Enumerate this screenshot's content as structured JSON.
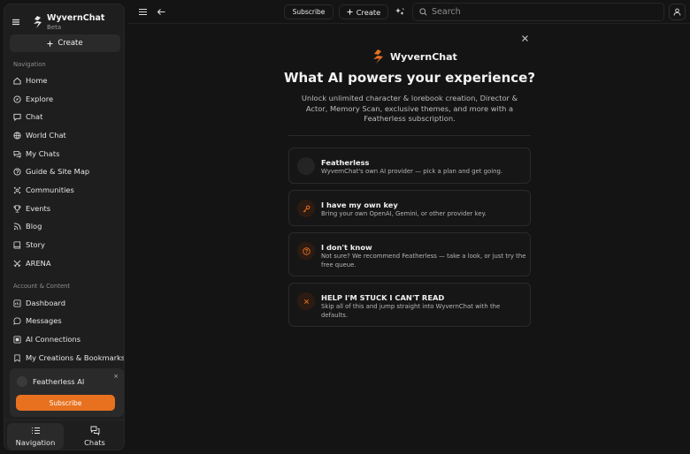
{
  "app": {
    "name": "WyvernChat",
    "tag": "Beta",
    "accent": "#e8711f"
  },
  "sidebar": {
    "create_label": "Create",
    "navigation_label": "Navigation",
    "nav_items": [
      {
        "label": "Home",
        "icon": "home-icon"
      },
      {
        "label": "Explore",
        "icon": "compass-icon"
      },
      {
        "label": "Chat",
        "icon": "chat-bubble-icon"
      },
      {
        "label": "World Chat",
        "icon": "globe-icon"
      },
      {
        "label": "My Chats",
        "icon": "chats-icon"
      },
      {
        "label": "Guide & Site Map",
        "icon": "map-icon"
      },
      {
        "label": "Communities",
        "icon": "people-icon"
      },
      {
        "label": "Events",
        "icon": "trophy-icon"
      },
      {
        "label": "Blog",
        "icon": "rss-icon"
      },
      {
        "label": "Story",
        "icon": "book-icon"
      },
      {
        "label": "ARENA",
        "icon": "swords-icon"
      }
    ],
    "account_label": "Account & Content",
    "account_items": [
      {
        "label": "Dashboard",
        "icon": "dashboard-icon"
      },
      {
        "label": "Messages",
        "icon": "message-icon"
      },
      {
        "label": "AI Connections",
        "icon": "connection-icon"
      },
      {
        "label": "My Creations & Bookmarks",
        "icon": "bookmark-icon"
      }
    ],
    "promo": {
      "title": "Featherless AI",
      "button": "Subscribe",
      "close": "×"
    },
    "tabs": {
      "navigation": "Navigation",
      "chats": "Chats"
    }
  },
  "topbar": {
    "subscribe_label": "Subscribe",
    "create_label": "Create",
    "search_placeholder": "Search"
  },
  "modal": {
    "brand": "WyvernChat",
    "title": "What AI powers your experience?",
    "description": "Unlock unlimited character & lorebook creation, Director & Actor, Memory Scan, exclusive themes, and more with a Featherless subscription.",
    "options": [
      {
        "title": "Featherless",
        "description": "WyvernChat's own AI provider — pick a plan and get going.",
        "icon": "featherless-logo-icon"
      },
      {
        "title": "I have my own key",
        "description": "Bring your own OpenAI, Gemini, or other provider key.",
        "icon": "key-icon"
      },
      {
        "title": "I don't know",
        "description": "Not sure? We recommend Featherless — take a look, or just try the free queue.",
        "icon": "question-icon"
      },
      {
        "title": "HELP I'M STUCK I CAN'T READ",
        "description": "Skip all of this and jump straight into WyvernChat with the defaults.",
        "icon": "x-icon"
      }
    ]
  }
}
